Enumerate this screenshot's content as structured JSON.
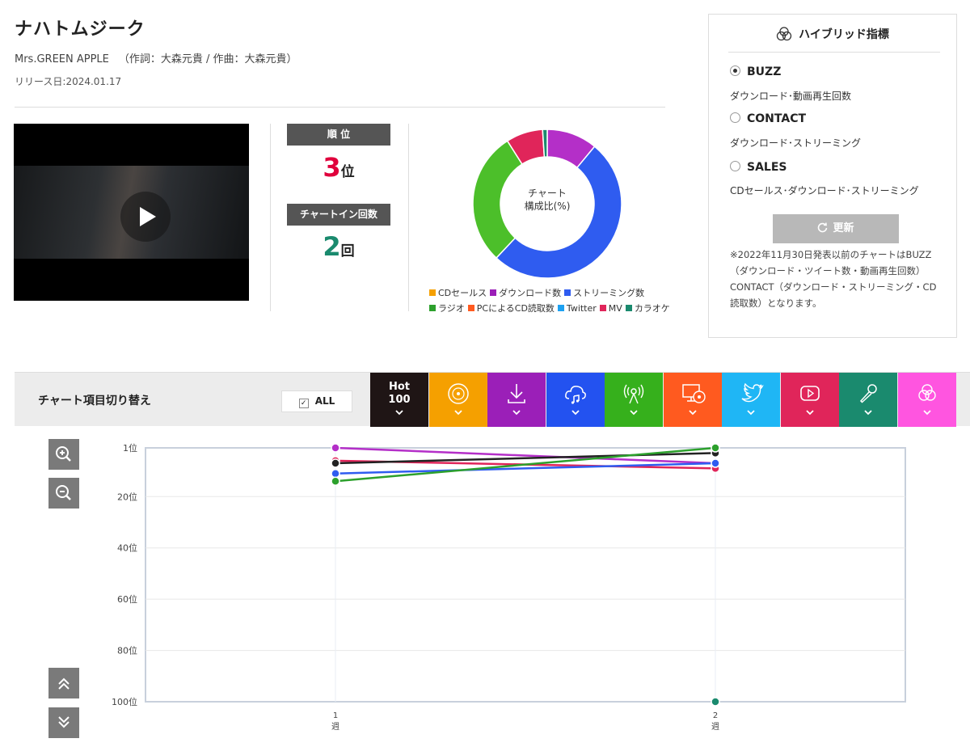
{
  "song": {
    "title": "ナハトムジーク",
    "artist": "Mrs.GREEN APPLE",
    "credits": "（作詞：大森元貴 / 作曲：大森元貴）",
    "release": "リリース日:2024.01.17"
  },
  "stats": {
    "rank_label": "順 位",
    "rank_value": "3",
    "rank_unit": "位",
    "chartin_label": "チャートイン回数",
    "chartin_value": "2",
    "chartin_unit": "回"
  },
  "composition": {
    "center_label_1": "チャート",
    "center_label_2": "構成比(%)",
    "slices": [
      {
        "name": "ダウンロード数",
        "value": 11,
        "color": "#b42fc8"
      },
      {
        "name": "ストリーミング数",
        "value": 51,
        "color": "#2f5cf0"
      },
      {
        "name": "ラジオ",
        "value": 29,
        "color": "#4cbf2a"
      },
      {
        "name": "MV",
        "value": 8,
        "color": "#e0255a"
      },
      {
        "name": "カラオケ",
        "value": 1,
        "color": "#1a8a6e"
      }
    ],
    "legend": [
      {
        "name": "CDセールス",
        "color": "#f5a000"
      },
      {
        "name": "ダウンロード数",
        "color": "#9b1fb8"
      },
      {
        "name": "ストリーミング数",
        "color": "#2f5cf0"
      },
      {
        "name": "ラジオ",
        "color": "#2ca02c"
      },
      {
        "name": "PCによるCD読取数",
        "color": "#ff5a1f"
      },
      {
        "name": "Twitter",
        "color": "#1da1f2"
      },
      {
        "name": "MV",
        "color": "#e0255a"
      },
      {
        "name": "カラオケ",
        "color": "#1a8a6e"
      }
    ]
  },
  "hybrid": {
    "title": "ハイブリッド指標",
    "options": [
      {
        "label": "BUZZ",
        "desc": "ダウンロード･動画再生回数",
        "selected": true
      },
      {
        "label": "CONTACT",
        "desc": "ダウンロード･ストリーミング",
        "selected": false
      },
      {
        "label": "SALES",
        "desc": "CDセールス･ダウンロード･ストリーミング",
        "selected": false
      }
    ],
    "update_label": "更新",
    "note": "※2022年11月30日発表以前のチャートはBUZZ（ダウンロード・ツイート数・動画再生回数）CONTACT（ダウンロード・ストリーミング・CD読取数）となります。"
  },
  "switcher": {
    "label": "チャート項目切り替え",
    "all_label": "ALL",
    "tabs": [
      {
        "name": "hot100",
        "text_1": "Hot",
        "text_2": "100",
        "color": "#1f1515"
      },
      {
        "name": "cd-sales",
        "icon": "disc-icon",
        "color": "#f5a000"
      },
      {
        "name": "download",
        "icon": "download-icon",
        "color": "#9b1fb8"
      },
      {
        "name": "streaming",
        "icon": "cloud-music-icon",
        "color": "#2352f0"
      },
      {
        "name": "radio",
        "icon": "radio-icon",
        "color": "#36b01c"
      },
      {
        "name": "pc-cd",
        "icon": "pc-disc-icon",
        "color": "#ff5a1f"
      },
      {
        "name": "twitter",
        "icon": "twitter-icon",
        "color": "#1fb6f5"
      },
      {
        "name": "mv",
        "icon": "youtube-icon",
        "color": "#e0255a"
      },
      {
        "name": "karaoke",
        "icon": "microphone-icon",
        "color": "#1a8a6e"
      },
      {
        "name": "hybrid",
        "icon": "hybrid-icon",
        "color": "#ff55e0"
      }
    ]
  },
  "chart_data": {
    "type": "line",
    "y_axis_reversed": true,
    "ylim": [
      1,
      100
    ],
    "y_ticks": [
      1,
      20,
      40,
      60,
      80,
      100
    ],
    "y_tick_suffix": "位",
    "x_categories": [
      "1",
      "2"
    ],
    "x_unit": "週",
    "grid": true,
    "series": [
      {
        "name": "ダウンロード数",
        "color": "#b42fc8",
        "values": [
          1,
          7
        ]
      },
      {
        "name": "MV",
        "color": "#e0255a",
        "values": [
          6,
          9
        ]
      },
      {
        "name": "Hot 100",
        "color": "#222222",
        "values": [
          7,
          3
        ]
      },
      {
        "name": "ストリーミング数",
        "color": "#2f5cf0",
        "values": [
          11,
          7
        ]
      },
      {
        "name": "ラジオ",
        "color": "#2ca02c",
        "values": [
          14,
          1
        ]
      },
      {
        "name": "カラオケ",
        "color": "#1a8a6e",
        "values": [
          null,
          100
        ]
      }
    ]
  }
}
